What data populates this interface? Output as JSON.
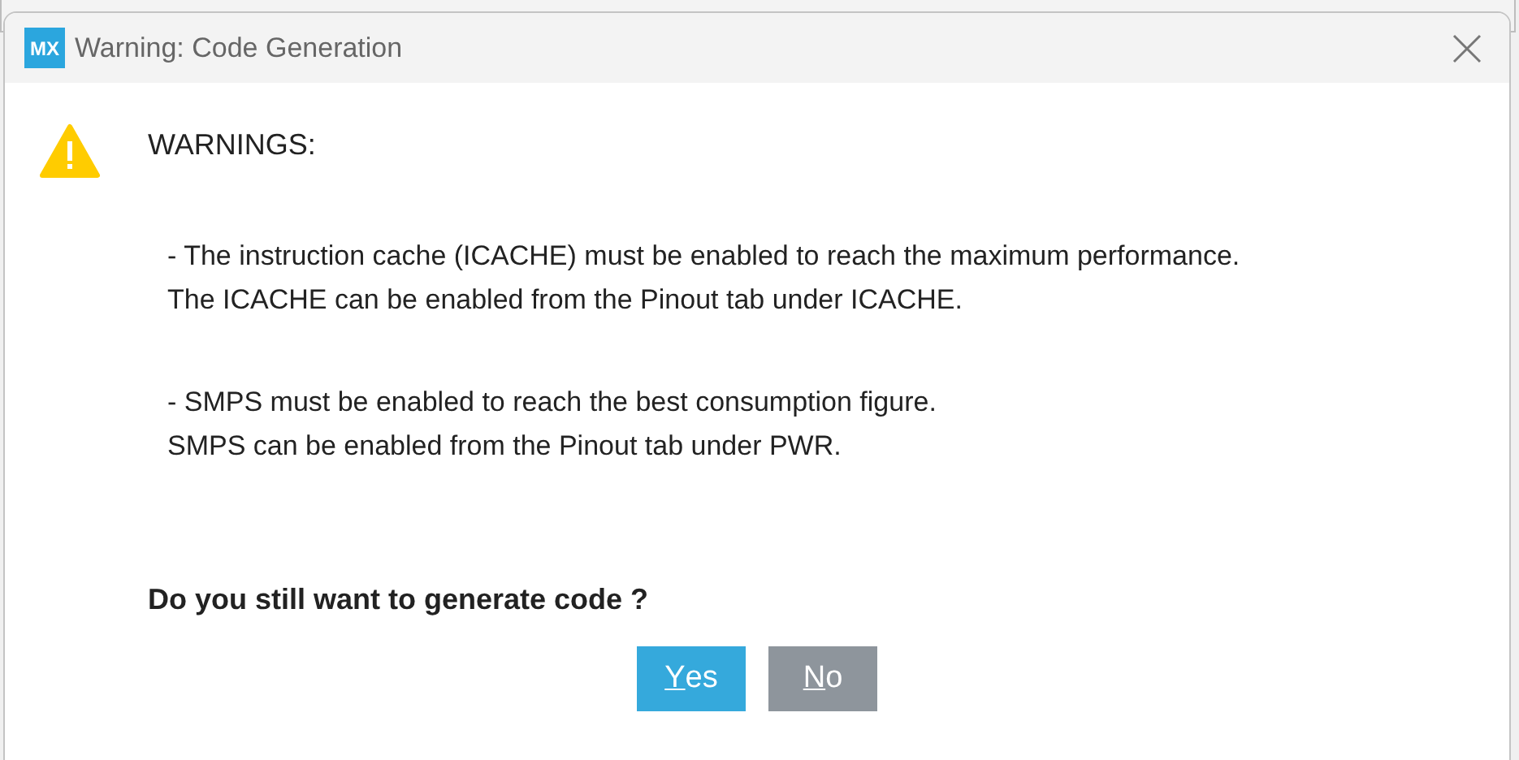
{
  "window": {
    "title": "Warning: Code Generation",
    "app_badge": "MX"
  },
  "heading": "WARNINGS:",
  "messages": [
    [
      "- The instruction cache (ICACHE) must be enabled to reach the maximum performance.",
      "The ICACHE can be enabled from the Pinout tab under ICACHE."
    ],
    [
      "- SMPS must be enabled to reach the best consumption figure.",
      "SMPS can be enabled from the Pinout tab under PWR."
    ]
  ],
  "question": "Do you still want to generate code ?",
  "buttons": [
    {
      "label": "Yes",
      "selected": true
    },
    {
      "label": "No",
      "selected": false
    }
  ]
}
